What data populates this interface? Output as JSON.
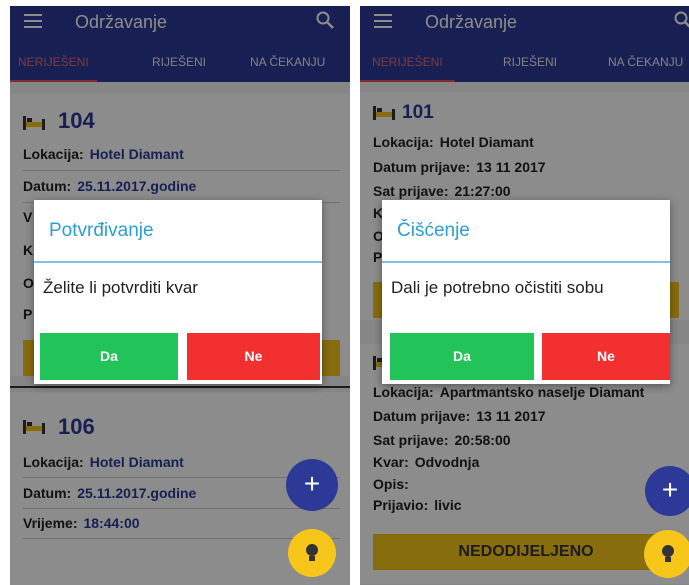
{
  "colors": {
    "app_bar": "#2d3996",
    "tab_active": "#ff5252",
    "yes_button": "#22c45a",
    "no_button": "#f23030",
    "dialog_title": "#2a9fd8",
    "fab_add": "#2d3996",
    "fab_bulb": "#f6c71a",
    "status_bar": "#f6c71a"
  },
  "left": {
    "app_title": "Održavanje",
    "tabs": [
      "NERIJEŠENI",
      "RIJEŠENI",
      "NA ČEKANJU"
    ],
    "card1": {
      "room": "104",
      "rows": [
        {
          "key": "Lokacija:",
          "value": "Hotel Diamant"
        },
        {
          "key": "Datum:",
          "value": "25.11.2017.godine"
        }
      ],
      "partial_rows": [
        "V",
        "K",
        "O",
        "P"
      ]
    },
    "card2": {
      "room": "106",
      "rows": [
        {
          "key": "Lokacija:",
          "value": "Hotel Diamant"
        },
        {
          "key": "Datum:",
          "value": "25.11.2017.godine"
        },
        {
          "key": "Vrijeme:",
          "value": "18:44:00"
        }
      ]
    },
    "dialog": {
      "title": "Potvrđivanje",
      "message": "Želite li potvrditi kvar",
      "yes": "Da",
      "no": "Ne"
    },
    "fab_add_icon": "plus-icon",
    "fab_bulb_icon": "lightbulb-icon"
  },
  "right": {
    "app_title": "Održavanje",
    "tabs": [
      "NERIJEŠENI",
      "RIJEŠENI",
      "NA ČEKANJU"
    ],
    "card1": {
      "room": "101",
      "rows": [
        {
          "key": "Lokacija:",
          "value": "Hotel Diamant"
        },
        {
          "key": "Datum prijave:",
          "value": "13 11 2017"
        },
        {
          "key": "Sat prijave:",
          "value": "21:27:00"
        }
      ],
      "partial_rows": [
        "K",
        "O",
        "P"
      ]
    },
    "card2": {
      "rows": [
        {
          "key": "Lokacija:",
          "value": "Apartmantsko naselje Diamant"
        },
        {
          "key": "Datum prijave:",
          "value": "13 11 2017"
        },
        {
          "key": "Sat prijave:",
          "value": "20:58:00"
        },
        {
          "key": "Kvar:",
          "value": "Odvodnja"
        },
        {
          "key": "Opis:",
          "value": ""
        },
        {
          "key": "Prijavio:",
          "value": "livic"
        }
      ],
      "status_button": "NEDODIJELJENO"
    },
    "dialog": {
      "title": "Čišćenje",
      "message": "Dali je potrebno očistiti sobu",
      "yes": "Da",
      "no": "Ne"
    },
    "fab_add_icon": "plus-icon",
    "fab_bulb_icon": "lightbulb-icon"
  }
}
